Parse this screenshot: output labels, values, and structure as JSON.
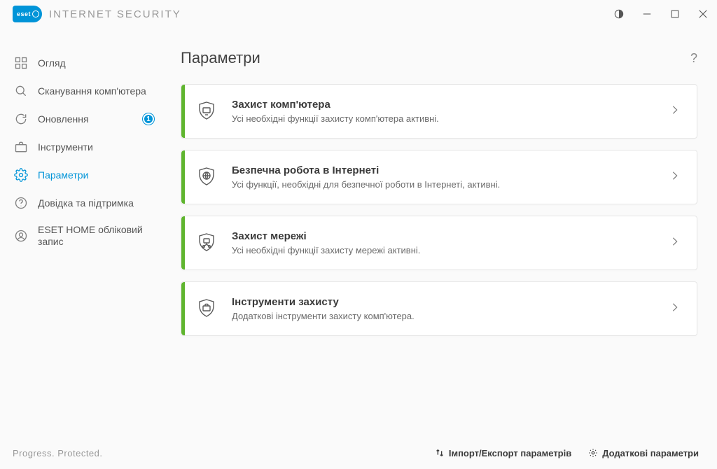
{
  "brand": {
    "short": "eset",
    "name": "INTERNET SECURITY"
  },
  "sidebar": {
    "items": [
      {
        "label": "Огляд"
      },
      {
        "label": "Сканування комп'ютера"
      },
      {
        "label": "Оновлення",
        "badge": "1"
      },
      {
        "label": "Інструменти"
      },
      {
        "label": "Параметри"
      },
      {
        "label": "Довідка та підтримка"
      },
      {
        "label": "ESET HOME обліковий запис"
      }
    ]
  },
  "page": {
    "title": "Параметри",
    "help": "?"
  },
  "cards": [
    {
      "title": "Захист комп'ютера",
      "desc": "Усі необхідні функції захисту комп'ютера активні."
    },
    {
      "title": "Безпечна робота в Інтернеті",
      "desc": "Усі функції, необхідні для безпечної роботи в Інтернеті, активні."
    },
    {
      "title": "Захист мережі",
      "desc": "Усі необхідні функції захисту мережі активні."
    },
    {
      "title": "Інструменти захисту",
      "desc": "Додаткові інструменти захисту комп'ютера."
    }
  ],
  "footer": {
    "slogan": "Progress. Protected.",
    "import_export": "Імпорт/Експорт параметрів",
    "advanced": "Додаткові параметри"
  }
}
